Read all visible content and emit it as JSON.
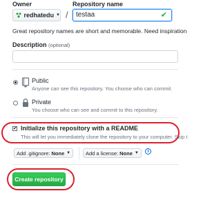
{
  "form": {
    "owner_label": "Owner",
    "owner_value": "redhatedu",
    "separator": "/",
    "name_label": "Repository name",
    "name_value": "testaa",
    "name_note": "Great repository names are short and memorable. Need inspiration",
    "description_label": "Description",
    "description_optional": "(optional)"
  },
  "visibility": {
    "public_title": "Public",
    "public_sub": "Anyone can see this repository. You choose who can commit.",
    "private_title": "Private",
    "private_sub": "You choose who can see and commit to this repository."
  },
  "init": {
    "title": "Initialize this repository with a README",
    "sub": "This will let you immediately clone the repository to your computer. Skip t"
  },
  "extras": {
    "gitignore_prefix": "Add .gitignore:",
    "gitignore_value": "None",
    "license_prefix": "Add a license:",
    "license_value": "None",
    "info_symbol": "i"
  },
  "actions": {
    "create_label": "Create repository"
  },
  "colors": {
    "primary": "#28a745",
    "annotation": "#d9212a",
    "focus": "#2188ff"
  },
  "icons": [
    "avatar-icon",
    "chevron-down-icon",
    "check-icon",
    "book-repo-icon",
    "lock-repo-icon",
    "info-icon"
  ]
}
